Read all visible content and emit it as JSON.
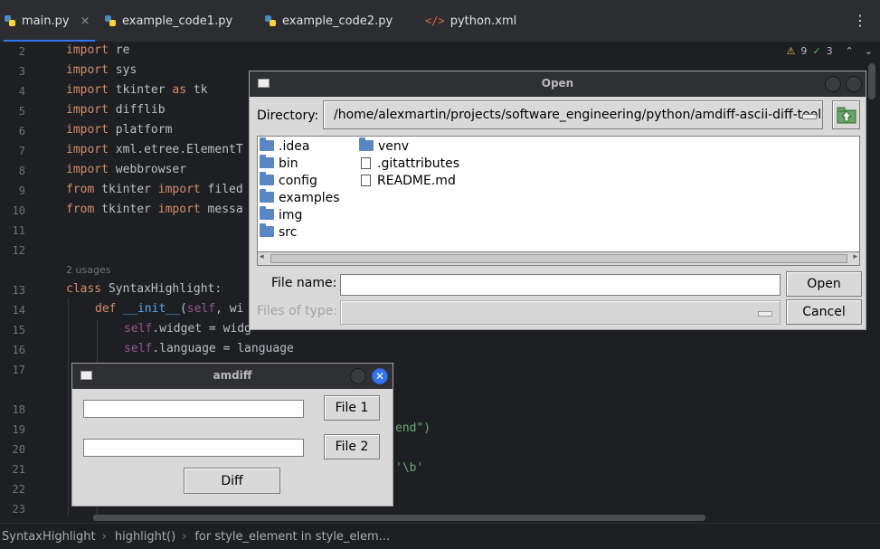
{
  "tabs": [
    {
      "label": "main.py",
      "active": true,
      "closable": true,
      "icon": "python-icon"
    },
    {
      "label": "example_code1.py",
      "icon": "python-icon"
    },
    {
      "label": "example_code2.py",
      "icon": "python-icon"
    },
    {
      "label": "python.xml",
      "icon": "xml-icon",
      "icon_text": "</>"
    }
  ],
  "inspections": {
    "warnings": "9",
    "ok": "3"
  },
  "editor": {
    "line_numbers": [
      "2",
      "3",
      "4",
      "5",
      "6",
      "7",
      "8",
      "9",
      "10",
      "11",
      "12",
      "13",
      "14",
      "15",
      "16",
      "17",
      "18",
      "19",
      "20",
      "21",
      "22",
      "23"
    ],
    "usages": "2 usages",
    "lines": [
      {
        "kw": "import",
        "rest": " re"
      },
      {
        "kw": "import",
        "rest": " sys"
      },
      {
        "kw": "import",
        "rest": " tkinter ",
        "kw2": "as",
        "rest2": " tk"
      },
      {
        "kw": "import",
        "rest": " difflib"
      },
      {
        "kw": "import",
        "rest": " platform"
      },
      {
        "kw": "import",
        "rest": " xml.etree.ElementT"
      },
      {
        "kw": "import",
        "rest": " webbrowser"
      },
      {
        "kw": "from",
        "rest": " tkinter ",
        "kw2": "import",
        "rest2": " filed"
      },
      {
        "kw": "from",
        "rest": " tkinter ",
        "kw2": "import",
        "rest2": " messa"
      },
      {
        "kw": "class",
        "rest": " SyntaxHighlight:"
      },
      {
        "kw": "def",
        "fn": " __init__",
        "rest": "(",
        "self": "self",
        "rest2": ", wi"
      },
      {
        "self": "self",
        "rest": ".widget = widg"
      },
      {
        "self": "self",
        "rest": ".language = language"
      }
    ],
    "fragment1": "end\")",
    "fragment2": "'\\b'"
  },
  "breadcrumb": [
    "SyntaxHighlight",
    "highlight()",
    "for style_element in style_elem..."
  ],
  "open_dialog": {
    "title": "Open",
    "directory_label": "Directory:",
    "directory_value": "/home/alexmartin/projects/software_engineering/python/amdiff-ascii-diff-tool",
    "folders_col1": [
      ".idea",
      "bin",
      "config",
      "examples",
      "img",
      "src"
    ],
    "col2_folders": [
      "venv"
    ],
    "col2_files": [
      ".gitattributes",
      "README.md"
    ],
    "file_name_label": "File name:",
    "file_name_value": "",
    "files_of_type_label": "Files of type:",
    "open_button": "Open",
    "cancel_button": "Cancel"
  },
  "amdiff_dialog": {
    "title": "amdiff",
    "file1_button": "File 1",
    "file2_button": "File 2",
    "diff_button": "Diff",
    "file1_value": "",
    "file2_value": ""
  },
  "colors": {
    "accent": "#3574f0",
    "keyword": "#cf8e6d",
    "self": "#94558d",
    "function": "#56a8f5",
    "string": "#6aab73"
  }
}
